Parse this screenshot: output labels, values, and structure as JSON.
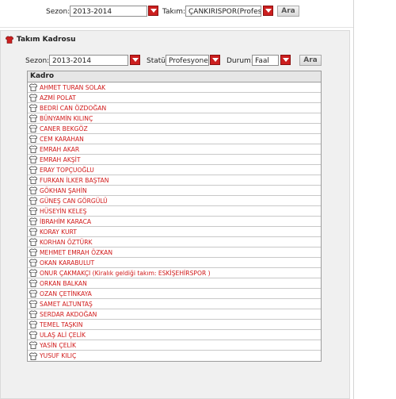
{
  "top_filter": {
    "season_label": "Sezon:",
    "season_value": "2013-2014",
    "team_label": "Takım:",
    "team_value": "ÇANKIRISPOR(Profesyonel)",
    "search_label": "Ara"
  },
  "panel": {
    "title": "Takım Kadrosu",
    "season_label": "Sezon:",
    "season_value": "2013-2014",
    "status_label": "Statü:",
    "status_value": "Profesyonel",
    "state_label": "Durum:",
    "state_value": "Faal",
    "search_label": "Ara"
  },
  "roster": {
    "header": "Kadro",
    "players": [
      "AHMET TURAN SOLAK",
      "AZMİ POLAT",
      "BEDRİ CAN ÖZDOĞAN",
      "BÜNYAMİN KILINÇ",
      "CANER BEKGÖZ",
      "CEM KARAHAN",
      "EMRAH AKAR",
      "EMRAH AKŞİT",
      "ERAY TOPÇUOĞLU",
      "FURKAN İLKER BAŞTAN",
      "GÖKHAN ŞAHİN",
      "GÜNEŞ CAN GÖRGÜLÜ",
      "HÜSEYİN KELEŞ",
      "İBRAHİM KARACA",
      "KORAY KURT",
      "KORHAN ÖZTÜRK",
      "MEHMET EMRAH ÖZKAN",
      "OKAN KARABULUT",
      "ONUR ÇAKMAKÇI (Kiralık geldiği takım: ESKİŞEHİRSPOR )",
      "ORKAN BALKAN",
      "OZAN ÇETİNKAYA",
      "SAMET ALTUNTAŞ",
      "SERDAR AKDOĞAN",
      "TEMEL TAŞKIN",
      "ULAŞ ALİ ÇELİK",
      "YASİN ÇELİK",
      "YUSUF KILIÇ"
    ]
  },
  "colors": {
    "accent": "#cc1f1f",
    "link": "#d01818"
  }
}
